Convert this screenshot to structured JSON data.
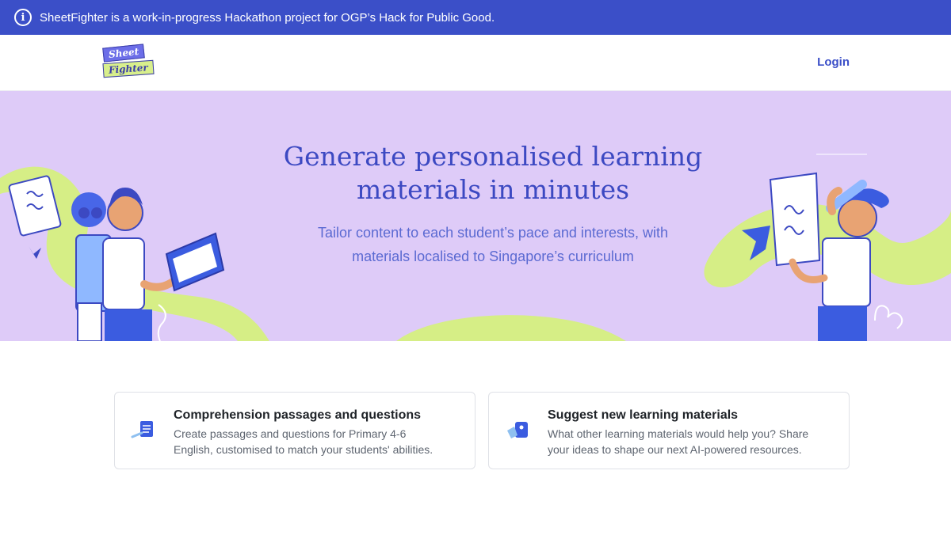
{
  "banner": {
    "icon": "info-icon",
    "text": "SheetFighter is a work-in-progress Hackathon project for OGP’s Hack for Public Good."
  },
  "header": {
    "logo_top": "Sheet",
    "logo_bottom": "Fighter",
    "login_label": "Login"
  },
  "hero": {
    "title_line1": "Generate personalised learning",
    "title_line2": "materials in minutes",
    "subtitle_line1": "Tailor content to each student’s pace and interests, with",
    "subtitle_line2": "materials localised to Singapore’s curriculum"
  },
  "cards": [
    {
      "icon": "document-icon",
      "title": "Comprehension passages and questions",
      "desc_line1": "Create passages and questions for Primary 4-6",
      "desc_line2": "English, customised to match your students' abilities."
    },
    {
      "icon": "tag-icon",
      "title": "Suggest new learning materials",
      "desc_line1": "What other learning materials would help you? Share",
      "desc_line2": "your ideas to shape our next AI-powered resources."
    }
  ],
  "colors": {
    "banner_bg": "#3b4fc8",
    "hero_bg": "#decbf8",
    "accent_green": "#d8ef8c",
    "title_blue": "#3c49c2"
  }
}
